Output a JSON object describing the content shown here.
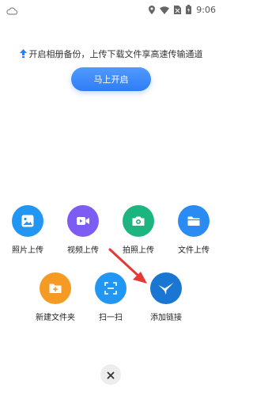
{
  "status_bar": {
    "time": "9:06"
  },
  "promo": {
    "text": "开启相册备份，上传下载文件享高速传输通道"
  },
  "cta": {
    "label": "马上开启"
  },
  "actions": [
    {
      "label": "照片上传",
      "color": "#2196F3",
      "icon": "photo-upload-icon"
    },
    {
      "label": "视频上传",
      "color": "#7C5CF2",
      "icon": "video-upload-icon"
    },
    {
      "label": "拍照上传",
      "color": "#1DB57F",
      "icon": "camera-upload-icon"
    },
    {
      "label": "文件上传",
      "color": "#2A8BF2",
      "icon": "file-upload-icon"
    },
    {
      "label": "新建文件夹",
      "color": "#F59A23",
      "icon": "new-folder-icon"
    },
    {
      "label": "扫一扫",
      "color": "#2196F3",
      "icon": "scan-icon"
    },
    {
      "label": "添加链接",
      "color": "#1976D2",
      "icon": "add-link-icon"
    }
  ],
  "close": {
    "icon": "close-icon"
  },
  "colors": {
    "accent": "#2F7DF6",
    "arrow": "#E53935"
  }
}
